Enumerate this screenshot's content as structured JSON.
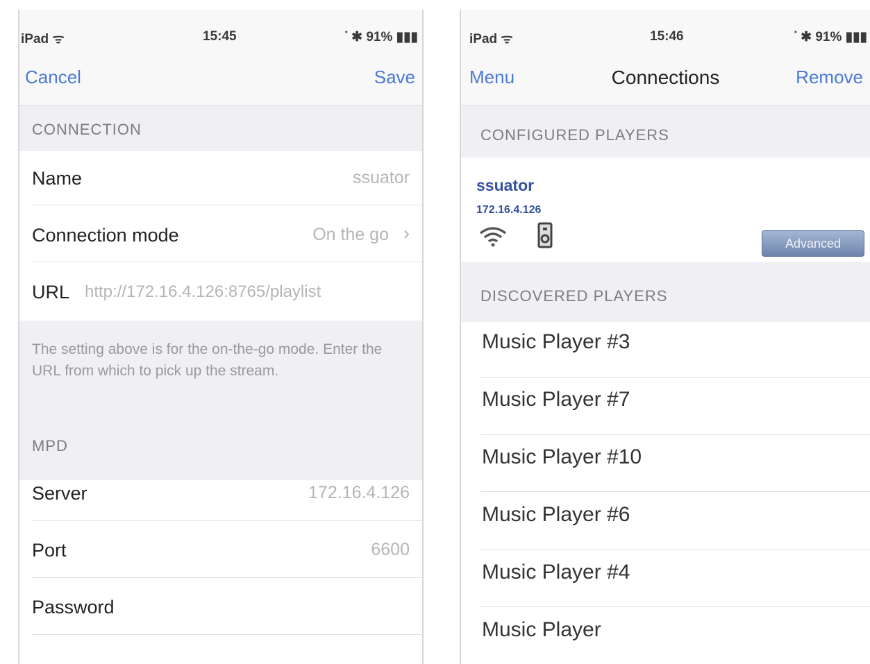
{
  "left_screen": {
    "status": {
      "carrier": "iPad ᯤ",
      "time": "15:45",
      "battery": "ᐝ ✱ 91% ▮▮▮"
    },
    "nav": {
      "cancel_label": "Cancel",
      "save_label": "Save"
    },
    "connection_section": {
      "header": "CONNECTION",
      "name_label": "Name",
      "name_value": "ssuator",
      "mode_label": "Connection mode",
      "mode_value": "On the go",
      "url_label": "URL",
      "url_value": "http://172.16.4.126:8765/playlist",
      "footer": "The setting above is for the on-the-go mode. Enter the URL from which to pick up the stream."
    },
    "mpd_section": {
      "header": "MPD",
      "server_label": "Server",
      "server_value": "172.16.4.126",
      "port_label": "Port",
      "port_value": "6600",
      "password_label": "Password"
    }
  },
  "right_screen": {
    "status": {
      "carrier": "iPad ᯤ",
      "time": "15:46",
      "battery": "ᐝ ✱ 91% ▮▮▮"
    },
    "nav": {
      "menu_label": "Menu",
      "title": "Connections",
      "remove_label": "Remove"
    },
    "configured": {
      "header": "CONFIGURED PLAYERS",
      "player_name": "ssuator",
      "player_ip": "172.16.4.126",
      "advanced_label": "Advanced"
    },
    "discovered": {
      "header": "DISCOVERED PLAYERS",
      "items": [
        "Music Player #3",
        "Music Player #7",
        "Music Player #10",
        "Music Player #6",
        "Music Player #4",
        "Music Player"
      ]
    }
  },
  "colors": {
    "accent": "#4a7ad3",
    "link_dark": "#3552a0",
    "group_bg": "#efeff4"
  },
  "icons": [
    "wifi-icon",
    "speaker-icon",
    "chevron-right-icon"
  ]
}
